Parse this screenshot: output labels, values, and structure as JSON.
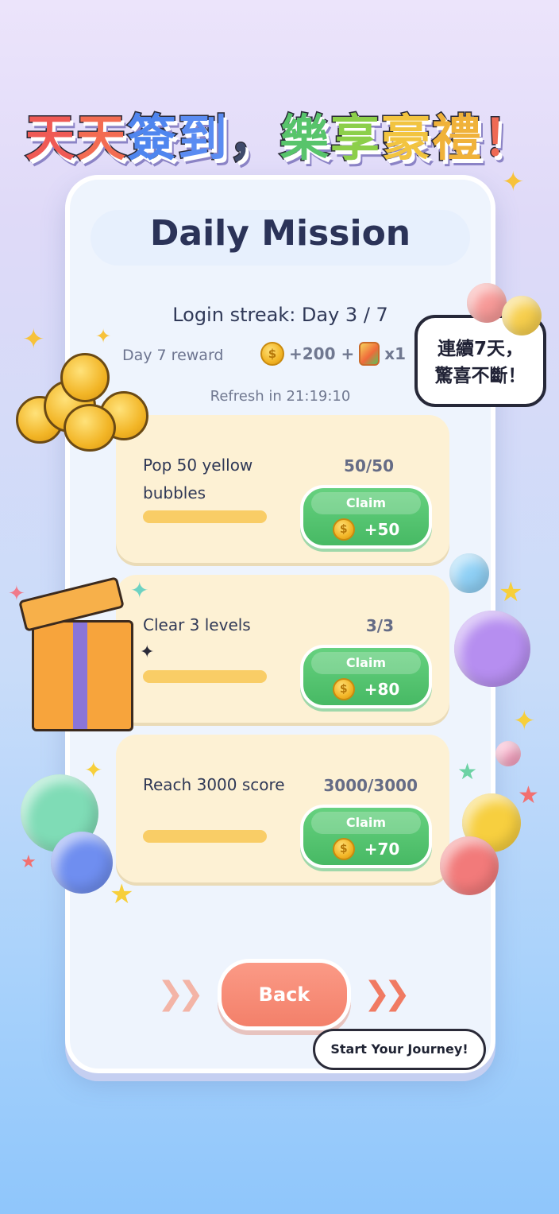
{
  "banner": {
    "chars": [
      "天",
      "天",
      "簽",
      "到",
      "，",
      "樂",
      "享",
      "豪",
      "禮",
      "！"
    ]
  },
  "card": {
    "title": "Daily Mission",
    "streak": "Login streak: Day 3 / 7",
    "reward_label": "Day 7 reward",
    "reward_coins": "+200 +",
    "reward_item": "x1",
    "refresh": "Refresh in 21:19:10"
  },
  "missions": [
    {
      "name": "Pop 50 yellow bubbles",
      "progress": "50/50",
      "progress_fraction": 1.0,
      "claim_label": "Claim",
      "reward": "+50"
    },
    {
      "name": "Clear 3 levels",
      "progress": "3/3",
      "progress_fraction": 1.0,
      "claim_label": "Claim",
      "reward": "+80"
    },
    {
      "name": "Reach 3000 score",
      "progress": "3000/3000",
      "progress_fraction": 1.0,
      "claim_label": "Claim",
      "reward": "+70"
    }
  ],
  "back_button": "Back",
  "journey_tag": "Start Your Journey!",
  "speech": {
    "line1": "連續7天，",
    "line2": "驚喜不斷！"
  },
  "coin_symbol": "$",
  "colors": {
    "claim_green": "#4fbf6b",
    "back_coral": "#f5866f",
    "mission_bg": "#fdf1d4",
    "title_navy": "#2b3358"
  }
}
